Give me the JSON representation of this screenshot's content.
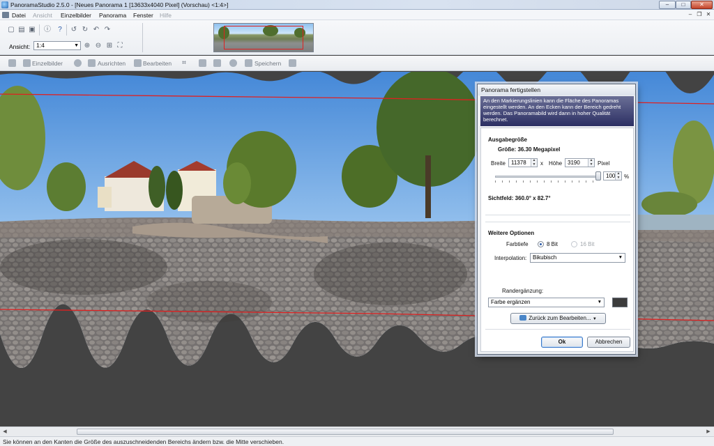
{
  "window": {
    "title": "PanoramaStudio 2.5.0 - [Neues Panorama 1 [13633x4040 Pixel] (Vorschau) <1:4>]",
    "minimize": "–",
    "maximize": "□",
    "close": "✕"
  },
  "menu": {
    "items": [
      {
        "label": "Datei",
        "enabled": true
      },
      {
        "label": "Ansicht",
        "enabled": false
      },
      {
        "label": "Einzelbilder",
        "enabled": true
      },
      {
        "label": "Panorama",
        "enabled": true
      },
      {
        "label": "Fenster",
        "enabled": true
      },
      {
        "label": "Hilfe",
        "enabled": false
      }
    ]
  },
  "toolbar": {
    "ansicht_label": "Ansicht:",
    "ansicht_value": "1:4"
  },
  "toolbar2": {
    "einzelbilder": "Einzelbilder",
    "ausrichten": "Ausrichten",
    "bearbeiten": "Bearbeiten",
    "speichern": "Speichern"
  },
  "dialog": {
    "title": "Panorama fertigstellen",
    "info": "An den Markierungslinien kann die Fläche des Panoramas eingestellt werden. An den Ecken kann der Bereich gedreht werden. Das Panoramabild wird dann in hoher Qualität berechnet.",
    "ausgabe": {
      "section_title": "Ausgabegröße",
      "groesse": "Größe: 36.30 Megapixel",
      "breite_label": "Breite",
      "breite_value": "11378",
      "x_label": "x",
      "hoehe_label": "Höhe",
      "hoehe_value": "3190",
      "pixel_label": "Pixel",
      "scale_value": "100",
      "percent_label": "%",
      "scale_level": 1.0,
      "sichtfeld": "Sichtfeld: 360.0° x 82.7°"
    },
    "weitere": {
      "section_title": "Weitere Optionen",
      "farbtiefe_label": "Farbtiefe",
      "bit8": "8 Bit",
      "bit16": "16 Bit",
      "interpolation_label": "Interpolation:",
      "interpolation_value": "Bikubisch",
      "randergaenzung_label": "Randergänzung:",
      "randergaenzung_value": "Farbe ergänzen",
      "fill_color": "#3c3c3c",
      "zurueck_button": "Zurück zum Bearbeiten..."
    },
    "ok_button": "Ok",
    "cancel_button": "Abbrechen"
  },
  "status": {
    "text": "Sie können an den Kanten die Größe des auszuschneidenden Bereichs ändern bzw. die Mitte verschieben."
  },
  "colors": {
    "crop_line": "#e02020",
    "canvas_background": "#434343"
  }
}
